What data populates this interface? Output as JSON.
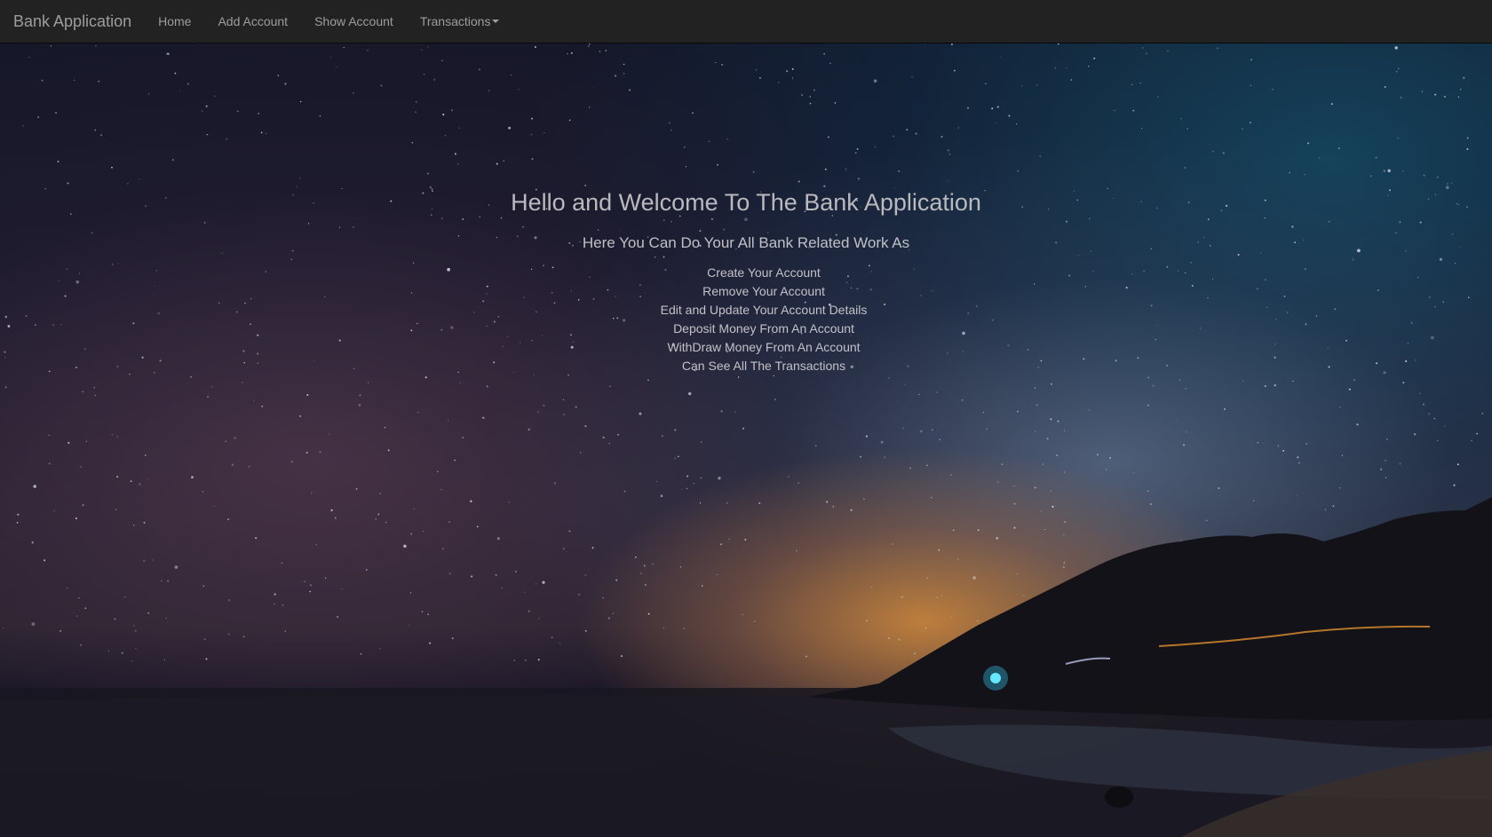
{
  "navbar": {
    "brand": "Bank Application",
    "links": {
      "home": "Home",
      "add_account": "Add Account",
      "show_account": "Show Account",
      "transactions": "Transactions"
    },
    "background_color": "#222222",
    "link_color": "#9d9d9d"
  },
  "hero": {
    "title": "Hello and Welcome To The Bank Application",
    "subtitle": "Here You Can Do Your All Bank Related Work As",
    "features": [
      "Create Your Account",
      "Remove Your Account",
      "Edit and Update Your Account Details",
      "Deposit Money From An Account",
      "WithDraw Money From An Account",
      "Can See All The Transactions"
    ]
  },
  "background": {
    "icon": "night-sky-beach-image"
  }
}
